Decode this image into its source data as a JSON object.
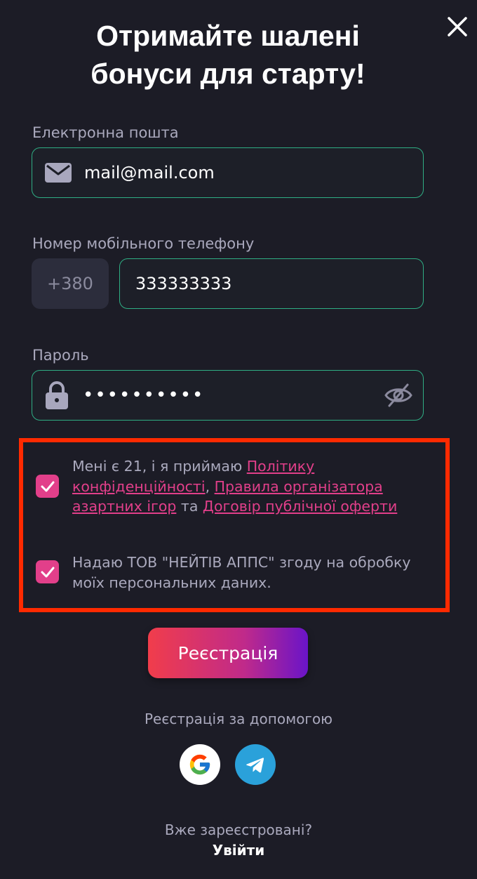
{
  "header": {
    "title_line1": "Отримайте шалені",
    "title_line2": "бонуси для старту!"
  },
  "email": {
    "label": "Електронна пошта",
    "value": "mail@mail.com",
    "icon": "mail-icon"
  },
  "phone": {
    "label": "Номер мобільного телефону",
    "prefix": "+380",
    "value": "333333333"
  },
  "password": {
    "label": "Пароль",
    "value": "••••••••••",
    "icon": "lock-icon",
    "toggle_icon": "eye-off-icon"
  },
  "consent": {
    "age": {
      "checked": true,
      "text_before": "Мені є 21, і я приймаю ",
      "link_privacy": "Політику конфіденційності",
      "comma": ", ",
      "link_rules": "Правила організатора азартних ігор",
      "and": " та ",
      "link_offer": "Договір публічної оферти"
    },
    "data": {
      "checked": true,
      "text": "Надаю ТОВ \"НЕЙТІВ АППС\" згоду на обробку моїх персональних даних."
    }
  },
  "register_button": "Реєстрація",
  "social": {
    "caption": "Реєстрація за допомогою",
    "providers": [
      "google-icon",
      "telegram-icon"
    ]
  },
  "footer": {
    "already": "Вже зареєстровані?",
    "login": "Увійти"
  },
  "colors": {
    "background": "#1c1c26",
    "field_border": "#2fae84",
    "accent_pink": "#e23f8a",
    "highlight_frame": "#ff2a00"
  }
}
